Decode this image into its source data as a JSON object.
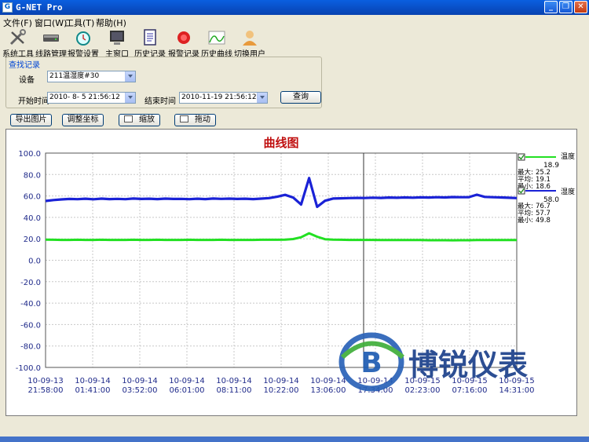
{
  "titlebar": {
    "title": "G-NET Pro",
    "icon": "G"
  },
  "menu": [
    {
      "label": "文件(F)"
    },
    {
      "label": "窗口(W)"
    },
    {
      "label": "工具(T)"
    },
    {
      "label": "帮助(H)"
    }
  ],
  "toolbar": [
    {
      "label": "系统工具",
      "icon": "tools-icon"
    },
    {
      "label": "线路管理",
      "icon": "device-icon"
    },
    {
      "label": "报警设置",
      "icon": "alarm-clock-icon"
    },
    {
      "label": "主窗口",
      "icon": "monitor-icon"
    },
    {
      "label": "历史记录",
      "icon": "document-icon"
    },
    {
      "label": "报警记录",
      "icon": "alarm-bell-icon"
    },
    {
      "label": "历史曲线",
      "icon": "curve-icon"
    },
    {
      "label": "切换用户",
      "icon": "user-icon"
    }
  ],
  "search": {
    "group_title": "查找记录",
    "device_label": "设备",
    "device_value": "211温湿度#30",
    "start_label": "开始时间",
    "start_value": "2010- 8- 5 21:56:12",
    "end_label": "结束时间",
    "end_value": "2010-11-19 21:56:12",
    "query_button": "查询"
  },
  "actions": {
    "export": "导出图片",
    "adjust": "调整坐标",
    "zoom": "缩放",
    "drag": "拖动"
  },
  "chart_data": {
    "type": "line",
    "title": "曲线图",
    "ylim": [
      -100,
      100
    ],
    "yticks": [
      "100.0",
      "80.0",
      "60.0",
      "40.0",
      "20.0",
      "0.0",
      "-20.0",
      "-40.0",
      "-60.0",
      "-80.0",
      "-100.0"
    ],
    "ytick_values": [
      100,
      80,
      60,
      40,
      20,
      0,
      -20,
      -40,
      -60,
      -80,
      -100
    ],
    "xticks": [
      {
        "date": "10-09-13",
        "time": "21:58:00"
      },
      {
        "date": "10-09-14",
        "time": "01:41:00"
      },
      {
        "date": "10-09-14",
        "time": "03:52:00"
      },
      {
        "date": "10-09-14",
        "time": "06:01:00"
      },
      {
        "date": "10-09-14",
        "time": "08:11:00"
      },
      {
        "date": "10-09-14",
        "time": "10:22:00"
      },
      {
        "date": "10-09-14",
        "time": "13:06:00"
      },
      {
        "date": "10-09-14",
        "time": "17:34:00"
      },
      {
        "date": "10-09-15",
        "time": "02:23:00"
      },
      {
        "date": "10-09-15",
        "time": "07:16:00"
      },
      {
        "date": "10-09-15",
        "time": "14:31:00"
      }
    ],
    "grid": true,
    "cursor_tick_index": 6.75,
    "series": [
      {
        "name": "温度",
        "color": "#22e022",
        "current": "18.9",
        "max": "25.2",
        "avg": "19.1",
        "min": "18.6",
        "max_label": "最大:",
        "avg_label": "平均:",
        "min_label": "最小:",
        "values": [
          19.2,
          19.1,
          19.0,
          19.0,
          19.1,
          19.0,
          19.0,
          19.1,
          19.0,
          19.0,
          19.0,
          19.1,
          19.0,
          19.0,
          19.1,
          19.0,
          19.0,
          19.0,
          19.1,
          19.0,
          19.0,
          19.0,
          19.1,
          19.0,
          19.0,
          19.0,
          19.0,
          19.1,
          19.1,
          19.1,
          19.3,
          19.8,
          21.5,
          25.2,
          22.0,
          19.6,
          19.2,
          19.1,
          19.0,
          19.0,
          19.0,
          19.0,
          18.9,
          18.9,
          18.9,
          18.8,
          18.8,
          18.8,
          18.7,
          18.7,
          18.7,
          18.6,
          18.7,
          18.7,
          18.8,
          18.8,
          18.8,
          18.9,
          18.9,
          18.9
        ]
      },
      {
        "name": "湿度",
        "color": "#1a22d6",
        "current": "58.0",
        "max": "76.7",
        "avg": "57.7",
        "min": "49.8",
        "max_label": "最大:",
        "avg_label": "平均:",
        "min_label": "最小:",
        "values": [
          55.3,
          56.2,
          56.8,
          57.2,
          57.0,
          57.4,
          56.9,
          57.5,
          57.1,
          57.3,
          57.0,
          57.6,
          57.2,
          57.4,
          57.1,
          57.5,
          57.2,
          57.3,
          57.0,
          57.4,
          57.1,
          57.6,
          57.3,
          57.5,
          57.2,
          57.4,
          57.1,
          57.5,
          58.0,
          59.3,
          61.0,
          58.5,
          52.0,
          76.7,
          49.8,
          55.5,
          57.6,
          57.8,
          58.0,
          58.2,
          58.1,
          58.4,
          58.2,
          58.5,
          58.3,
          58.6,
          58.4,
          58.7,
          58.5,
          58.8,
          58.6,
          59.0,
          58.8,
          58.9,
          61.2,
          59.1,
          58.8,
          58.6,
          58.3,
          58.0
        ]
      }
    ]
  },
  "watermark": {
    "text": "博锐仪表",
    "letter": "B"
  }
}
